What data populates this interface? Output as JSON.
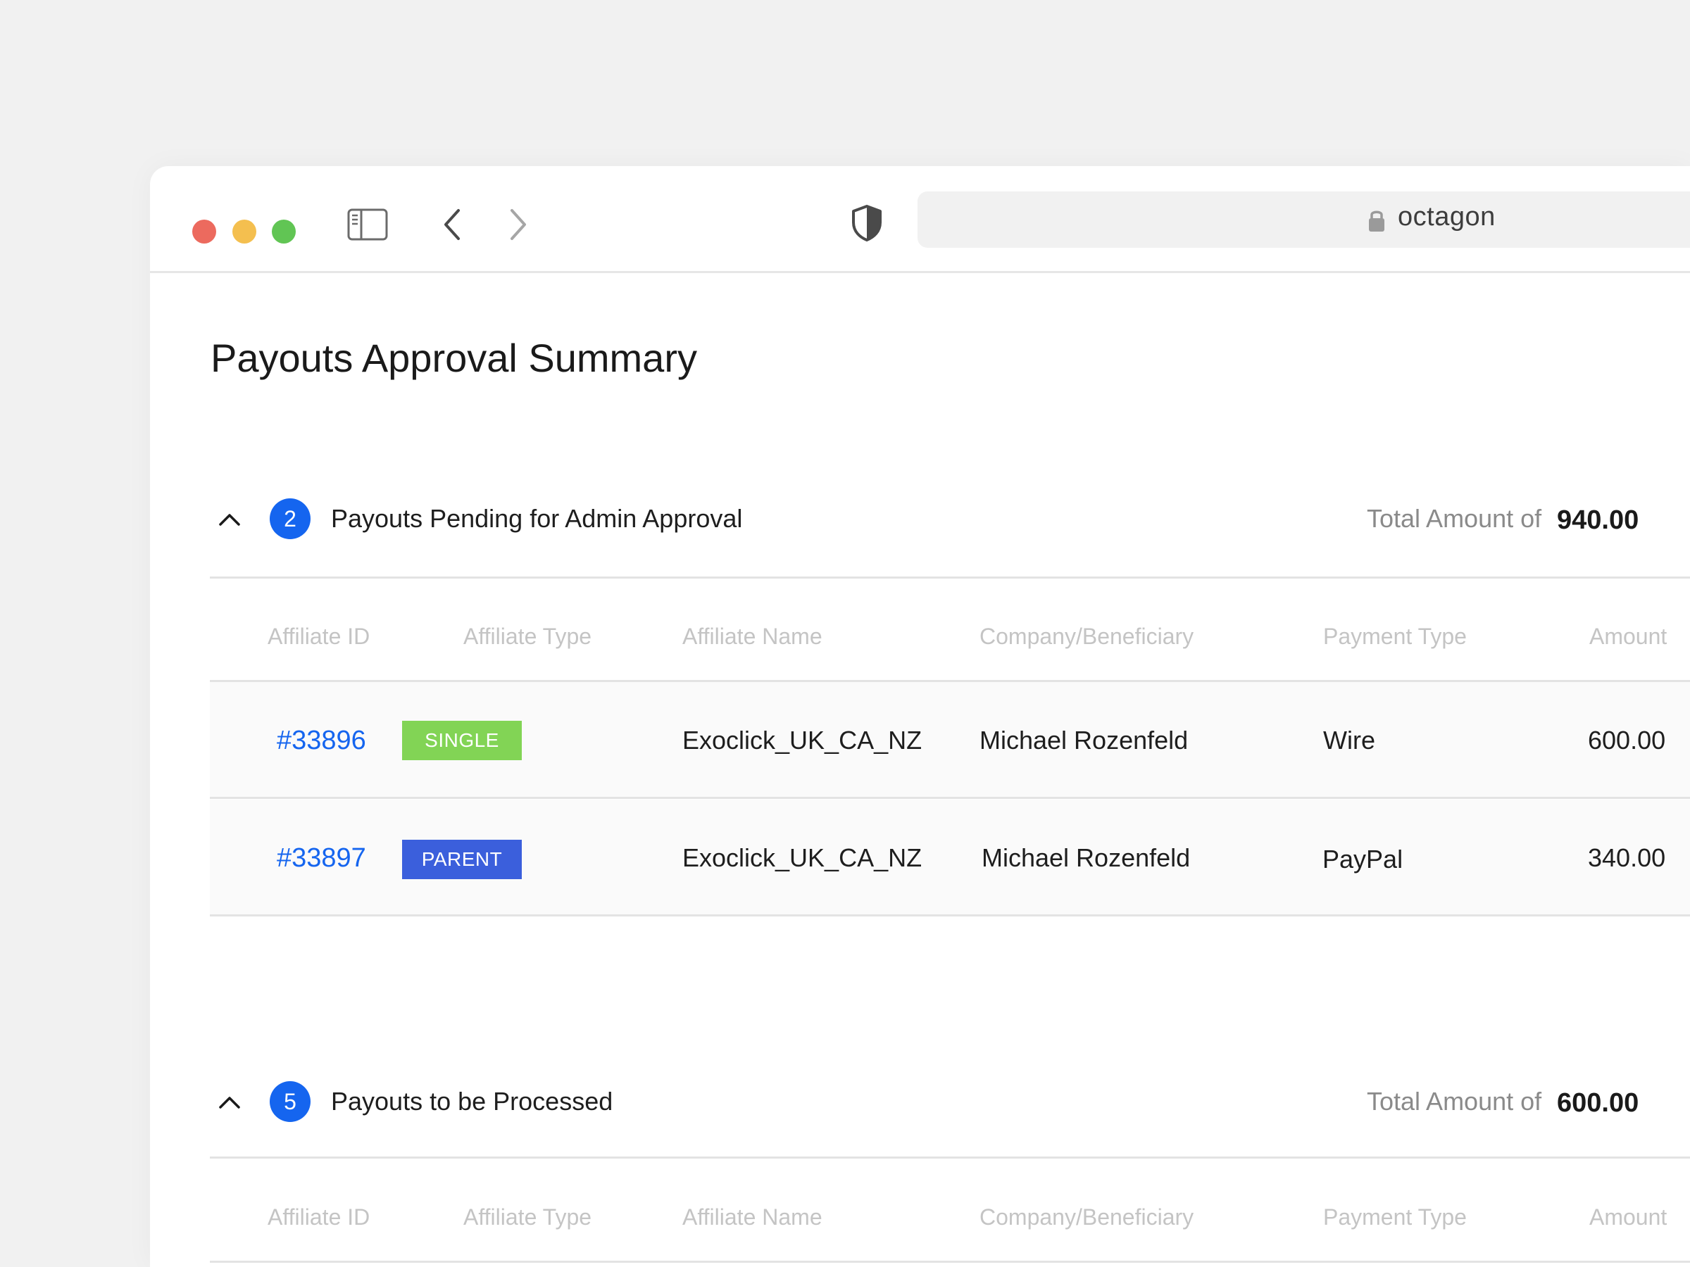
{
  "browser": {
    "url": "octagon"
  },
  "page": {
    "title": "Payouts Approval Summary"
  },
  "columns": [
    "Affiliate ID",
    "Affiliate Type",
    "Affiliate Name",
    "Company/Beneficiary",
    "Payment Type",
    "Amount"
  ],
  "sections": [
    {
      "count": "2",
      "title": "Payouts Pending for Admin Approval",
      "total_label": "Total Amount of",
      "total_value": "940.00",
      "rows": [
        {
          "id": "#33896",
          "type": "SINGLE",
          "type_color": "#82d455",
          "name": "Exoclick_UK_CA_NZ",
          "company": "Michael Rozenfeld",
          "payment": "Wire",
          "amount": "600.00"
        },
        {
          "id": "#33897",
          "type": "PARENT",
          "type_color": "#3b5fdc",
          "name": "Exoclick_UK_CA_NZ",
          "company": "Michael Rozenfeld",
          "payment": "PayPal",
          "amount": "340.00"
        }
      ]
    },
    {
      "count": "5",
      "title": "Payouts to be Processed",
      "total_label": "Total Amount of",
      "total_value": "600.00",
      "rows": []
    }
  ],
  "colors": {
    "accent": "#1565ef",
    "single_tag": "#82d455",
    "parent_tag": "#3b5fdc"
  },
  "icons": [
    "sidebar-toggle-icon",
    "back-arrow-icon",
    "forward-arrow-icon",
    "shield-icon",
    "lock-icon",
    "chevron-up-icon"
  ]
}
